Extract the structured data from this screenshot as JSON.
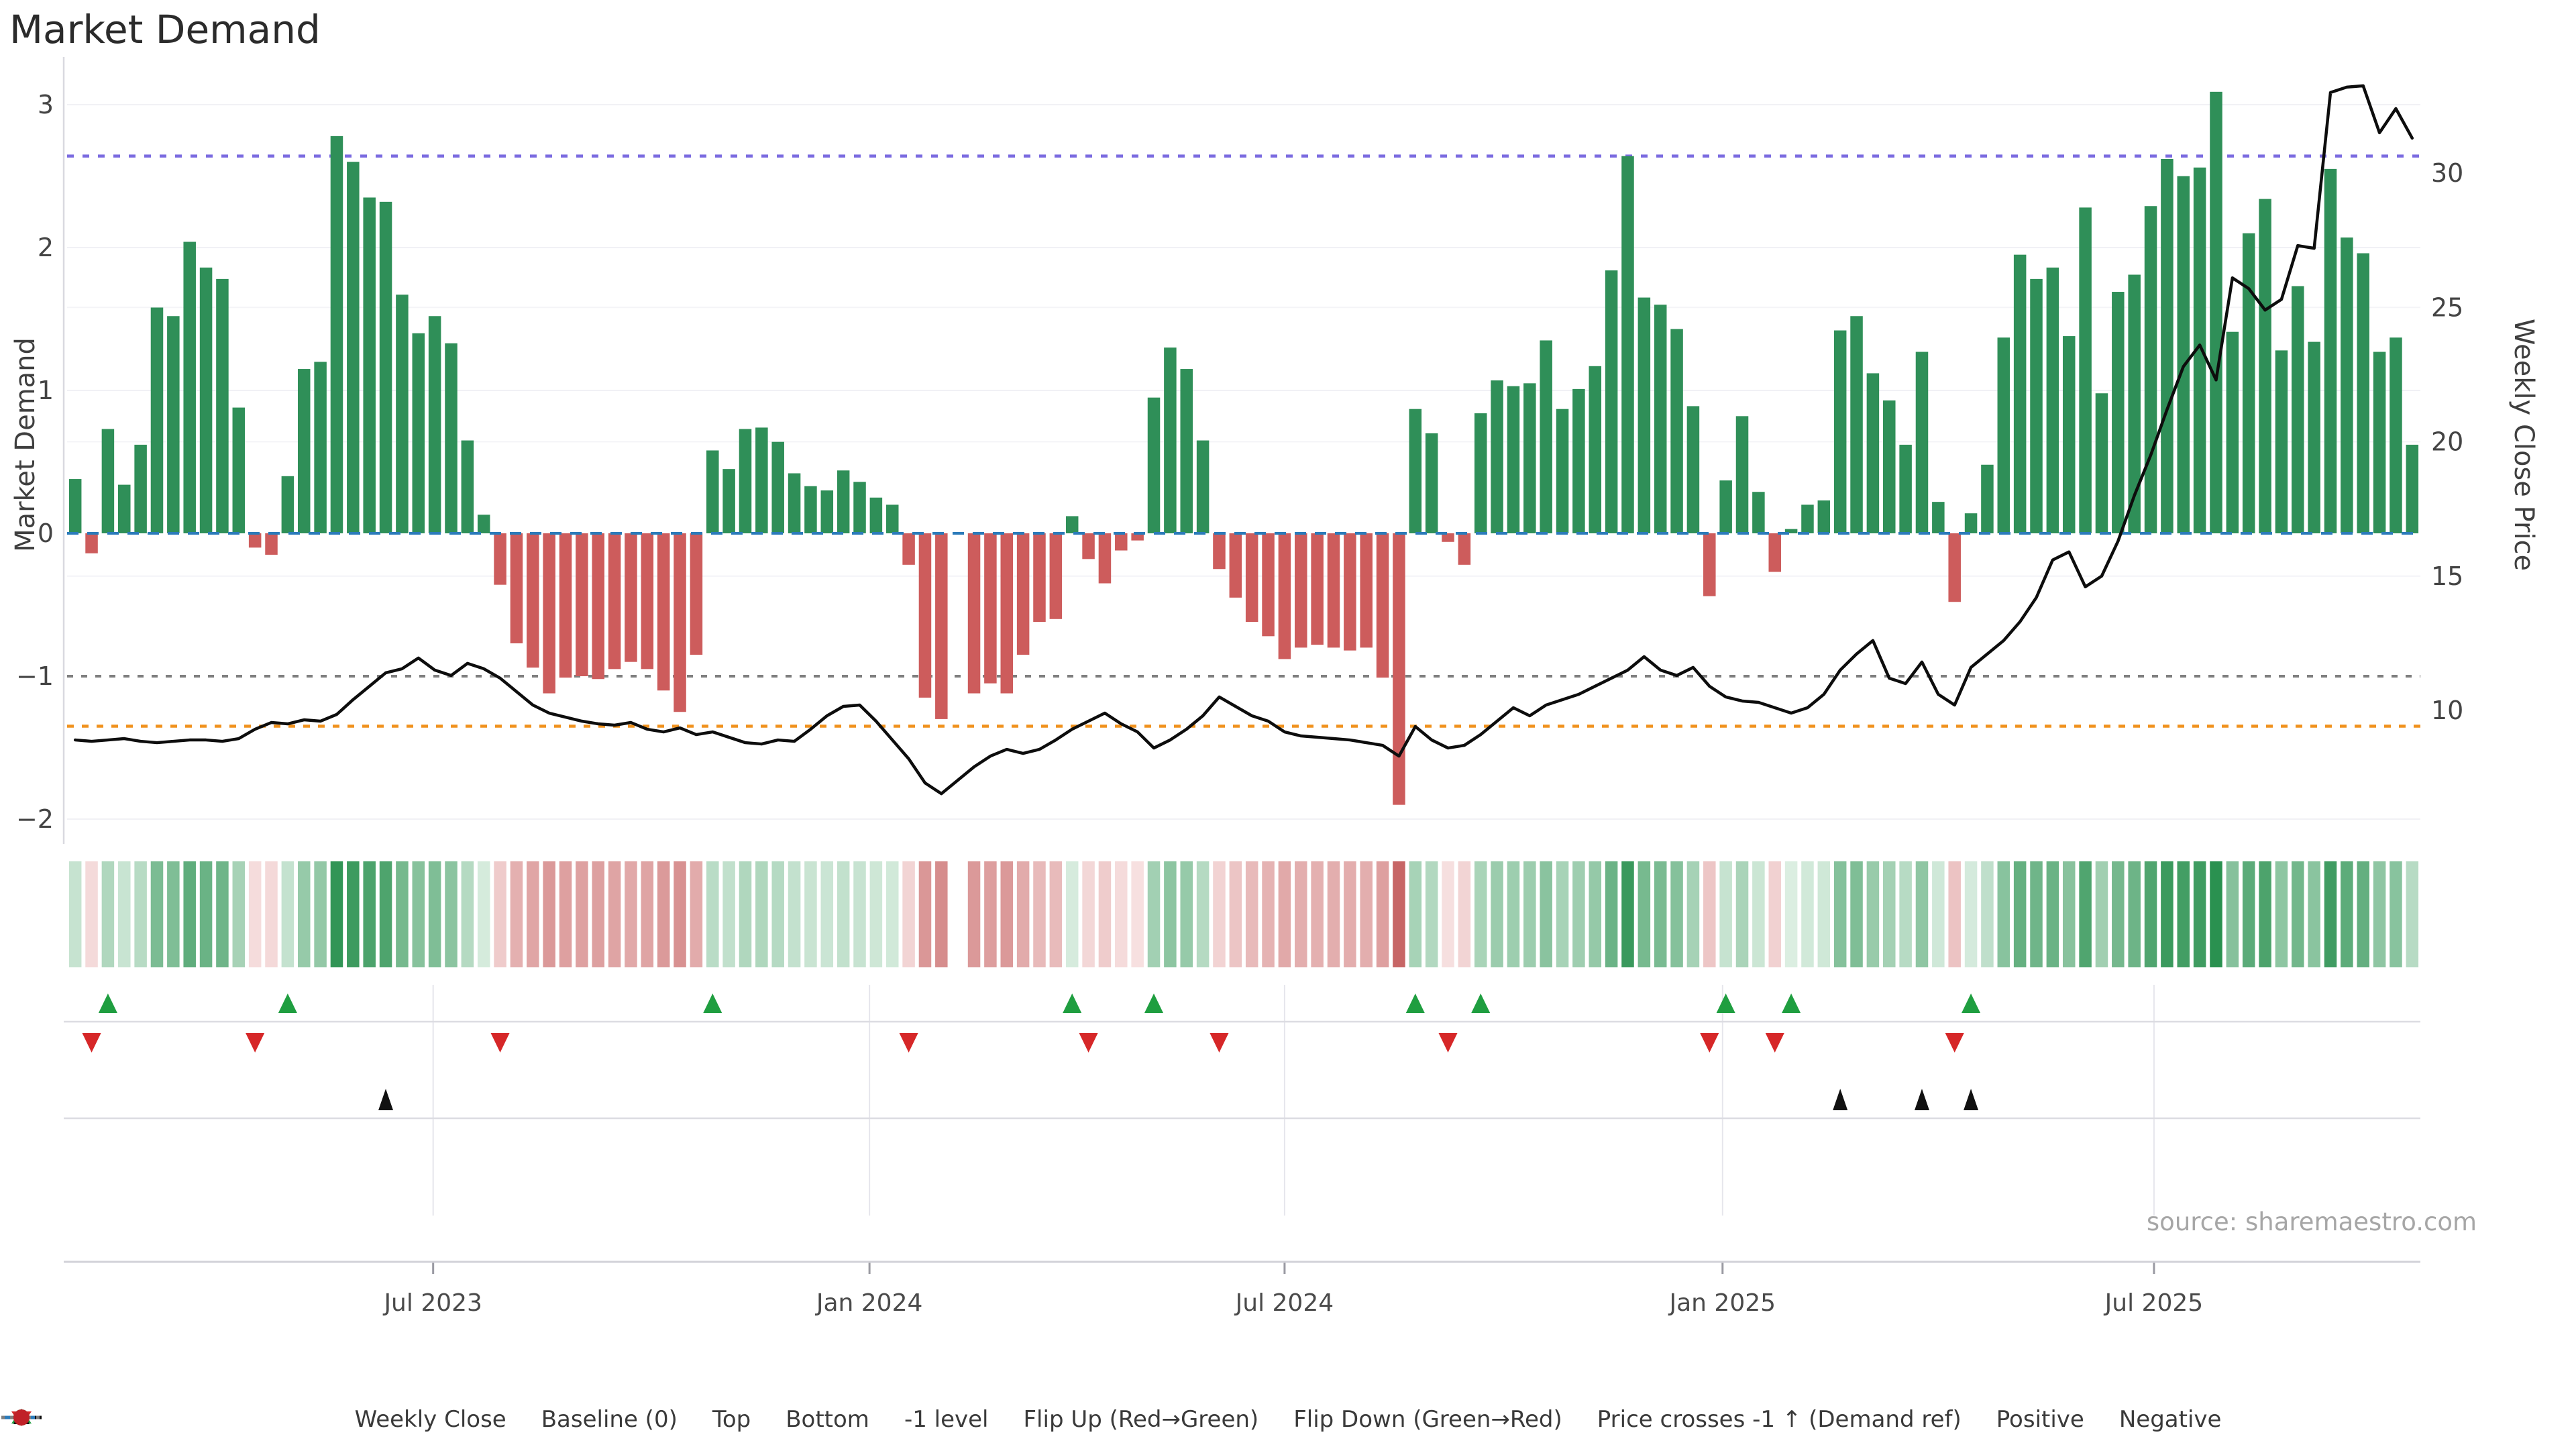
{
  "title": "Market Demand",
  "source": "source: sharemaestro.com",
  "colors": {
    "positive_bar": "#2f8f58",
    "negative_bar": "#cd5c5c",
    "baseline": "#2b7bba",
    "top_line": "#7b6be0",
    "bottom_line": "#f0921e",
    "minus_one_line": "#7f7f7f",
    "price_line": "#0d0d0d",
    "flip_up": "#1f9e40",
    "flip_down": "#d62728",
    "price_cross": "#111111",
    "heat_pos_dark": "#2a9150",
    "heat_pos_light": "#ddefe3",
    "heat_neg_dark": "#c45f5f",
    "heat_neg_light": "#f8e3e3"
  },
  "chart_data": {
    "type": "bar",
    "title": "Market Demand",
    "left_axis": {
      "label": "Market Demand",
      "ticks": [
        3,
        2,
        1,
        0,
        -1,
        -2
      ]
    },
    "right_axis": {
      "label": "Weekly Close Price",
      "ticks": [
        30,
        25,
        20,
        15,
        10
      ]
    },
    "x_ticks": [
      {
        "label": "Jul 2023",
        "week": 21.9
      },
      {
        "label": "Jan 2024",
        "week": 48.6
      },
      {
        "label": "Jul 2024",
        "week": 74.0
      },
      {
        "label": "Jan 2025",
        "week": 100.8
      },
      {
        "label": "Jul 2025",
        "week": 127.2
      }
    ],
    "reference_lines": {
      "baseline": 0,
      "top": 2.64,
      "bottom": -1.35,
      "minus_one": -1
    },
    "series": [
      {
        "name": "Market Demand (weekly bars)",
        "values": [
          0.38,
          -0.14,
          0.73,
          0.34,
          0.62,
          1.58,
          1.52,
          2.04,
          1.86,
          1.78,
          0.88,
          -0.1,
          -0.15,
          0.4,
          1.15,
          1.2,
          2.78,
          2.6,
          2.35,
          2.32,
          1.67,
          1.4,
          1.52,
          1.33,
          0.65,
          0.13,
          -0.36,
          -0.77,
          -0.94,
          -1.12,
          -1.01,
          -1.0,
          -1.02,
          -0.95,
          -0.9,
          -0.95,
          -1.1,
          -1.25,
          -0.85,
          0.58,
          0.45,
          0.73,
          0.74,
          0.64,
          0.42,
          0.33,
          0.3,
          0.44,
          0.36,
          0.25,
          0.2,
          -0.22,
          -1.15,
          -1.3,
          null,
          -1.12,
          -1.05,
          -1.12,
          -0.85,
          -0.62,
          -0.6,
          0.12,
          -0.18,
          -0.35,
          -0.12,
          -0.05,
          0.95,
          1.3,
          1.15,
          0.65,
          -0.25,
          -0.45,
          -0.62,
          -0.72,
          -0.88,
          -0.8,
          -0.78,
          -0.8,
          -0.82,
          -0.8,
          -1.01,
          -1.9,
          0.87,
          0.7,
          -0.06,
          -0.22,
          0.84,
          1.07,
          1.03,
          1.05,
          1.35,
          0.87,
          1.01,
          1.17,
          1.84,
          2.64,
          1.65,
          1.6,
          1.43,
          0.89,
          -0.44,
          0.37,
          0.82,
          0.29,
          -0.27,
          0.03,
          0.2,
          0.23,
          1.42,
          1.52,
          1.12,
          0.93,
          0.62,
          1.27,
          0.22,
          -0.48,
          0.14,
          0.48,
          1.37,
          1.95,
          1.78,
          1.86,
          1.38,
          2.28,
          0.98,
          1.69,
          1.81,
          2.29,
          2.62,
          2.5,
          2.56,
          3.09,
          1.41,
          2.1,
          2.34,
          1.28,
          1.73,
          1.34,
          2.55,
          2.07,
          1.96,
          1.27,
          1.37,
          0.62
        ]
      },
      {
        "name": "Weekly Close",
        "values": [
          8.9,
          8.85,
          8.9,
          8.95,
          8.85,
          8.8,
          8.85,
          8.9,
          8.9,
          8.85,
          8.95,
          9.3,
          9.55,
          9.5,
          9.65,
          9.6,
          9.85,
          10.4,
          10.9,
          11.4,
          11.55,
          11.95,
          11.5,
          11.3,
          11.75,
          11.55,
          11.2,
          10.7,
          10.2,
          9.9,
          9.75,
          9.6,
          9.5,
          9.45,
          9.55,
          9.3,
          9.2,
          9.35,
          9.1,
          9.2,
          9.0,
          8.8,
          8.75,
          8.9,
          8.85,
          9.3,
          9.8,
          10.15,
          10.2,
          9.6,
          8.9,
          8.2,
          7.3,
          6.9,
          7.4,
          7.9,
          8.3,
          8.55,
          8.4,
          8.55,
          8.9,
          9.3,
          9.6,
          9.9,
          9.5,
          9.2,
          8.6,
          8.9,
          9.3,
          9.8,
          10.5,
          10.15,
          9.8,
          9.6,
          9.2,
          9.05,
          9.0,
          8.95,
          8.9,
          8.8,
          8.7,
          8.3,
          9.4,
          8.9,
          8.6,
          8.7,
          9.1,
          9.6,
          10.1,
          9.8,
          10.2,
          10.4,
          10.6,
          10.9,
          11.2,
          11.5,
          12.0,
          11.5,
          11.3,
          11.6,
          10.9,
          10.5,
          10.35,
          10.3,
          10.1,
          9.9,
          10.1,
          10.6,
          11.5,
          12.1,
          12.6,
          11.2,
          11.0,
          11.8,
          10.6,
          10.2,
          11.6,
          12.1,
          12.6,
          13.3,
          14.2,
          15.6,
          15.9,
          14.6,
          15.0,
          16.3,
          18.0,
          19.5,
          21.2,
          22.8,
          23.6,
          22.3,
          26.1,
          25.7,
          24.9,
          25.3,
          27.3,
          27.2,
          33.0,
          33.2,
          33.25,
          31.5,
          32.4,
          31.3
        ]
      }
    ],
    "flip_up_weeks": [
      2,
      13,
      39,
      61,
      66,
      82,
      86,
      101,
      105,
      116
    ],
    "flip_down_weeks": [
      1,
      11,
      26,
      51,
      62,
      70,
      84,
      100,
      104,
      115
    ],
    "price_cross_weeks": [
      19,
      108,
      113,
      116
    ]
  },
  "legend": [
    {
      "label": "Weekly Close",
      "swatch": "line-black"
    },
    {
      "label": "Baseline (0)",
      "swatch": "dash-blue"
    },
    {
      "label": "Top",
      "swatch": "dot-purple"
    },
    {
      "label": "Bottom",
      "swatch": "dot-orange"
    },
    {
      "label": "-1 level",
      "swatch": "dot-gray"
    },
    {
      "label": "Flip Up (Red→Green)",
      "swatch": "tri-up-green"
    },
    {
      "label": "Flip Down (Green→Red)",
      "swatch": "tri-down-red"
    },
    {
      "label": "Price crosses -1 ↑ (Demand ref)",
      "swatch": "tri-up-black"
    },
    {
      "label": "Positive",
      "swatch": "circle-green"
    },
    {
      "label": "Negative",
      "swatch": "circle-red"
    }
  ]
}
